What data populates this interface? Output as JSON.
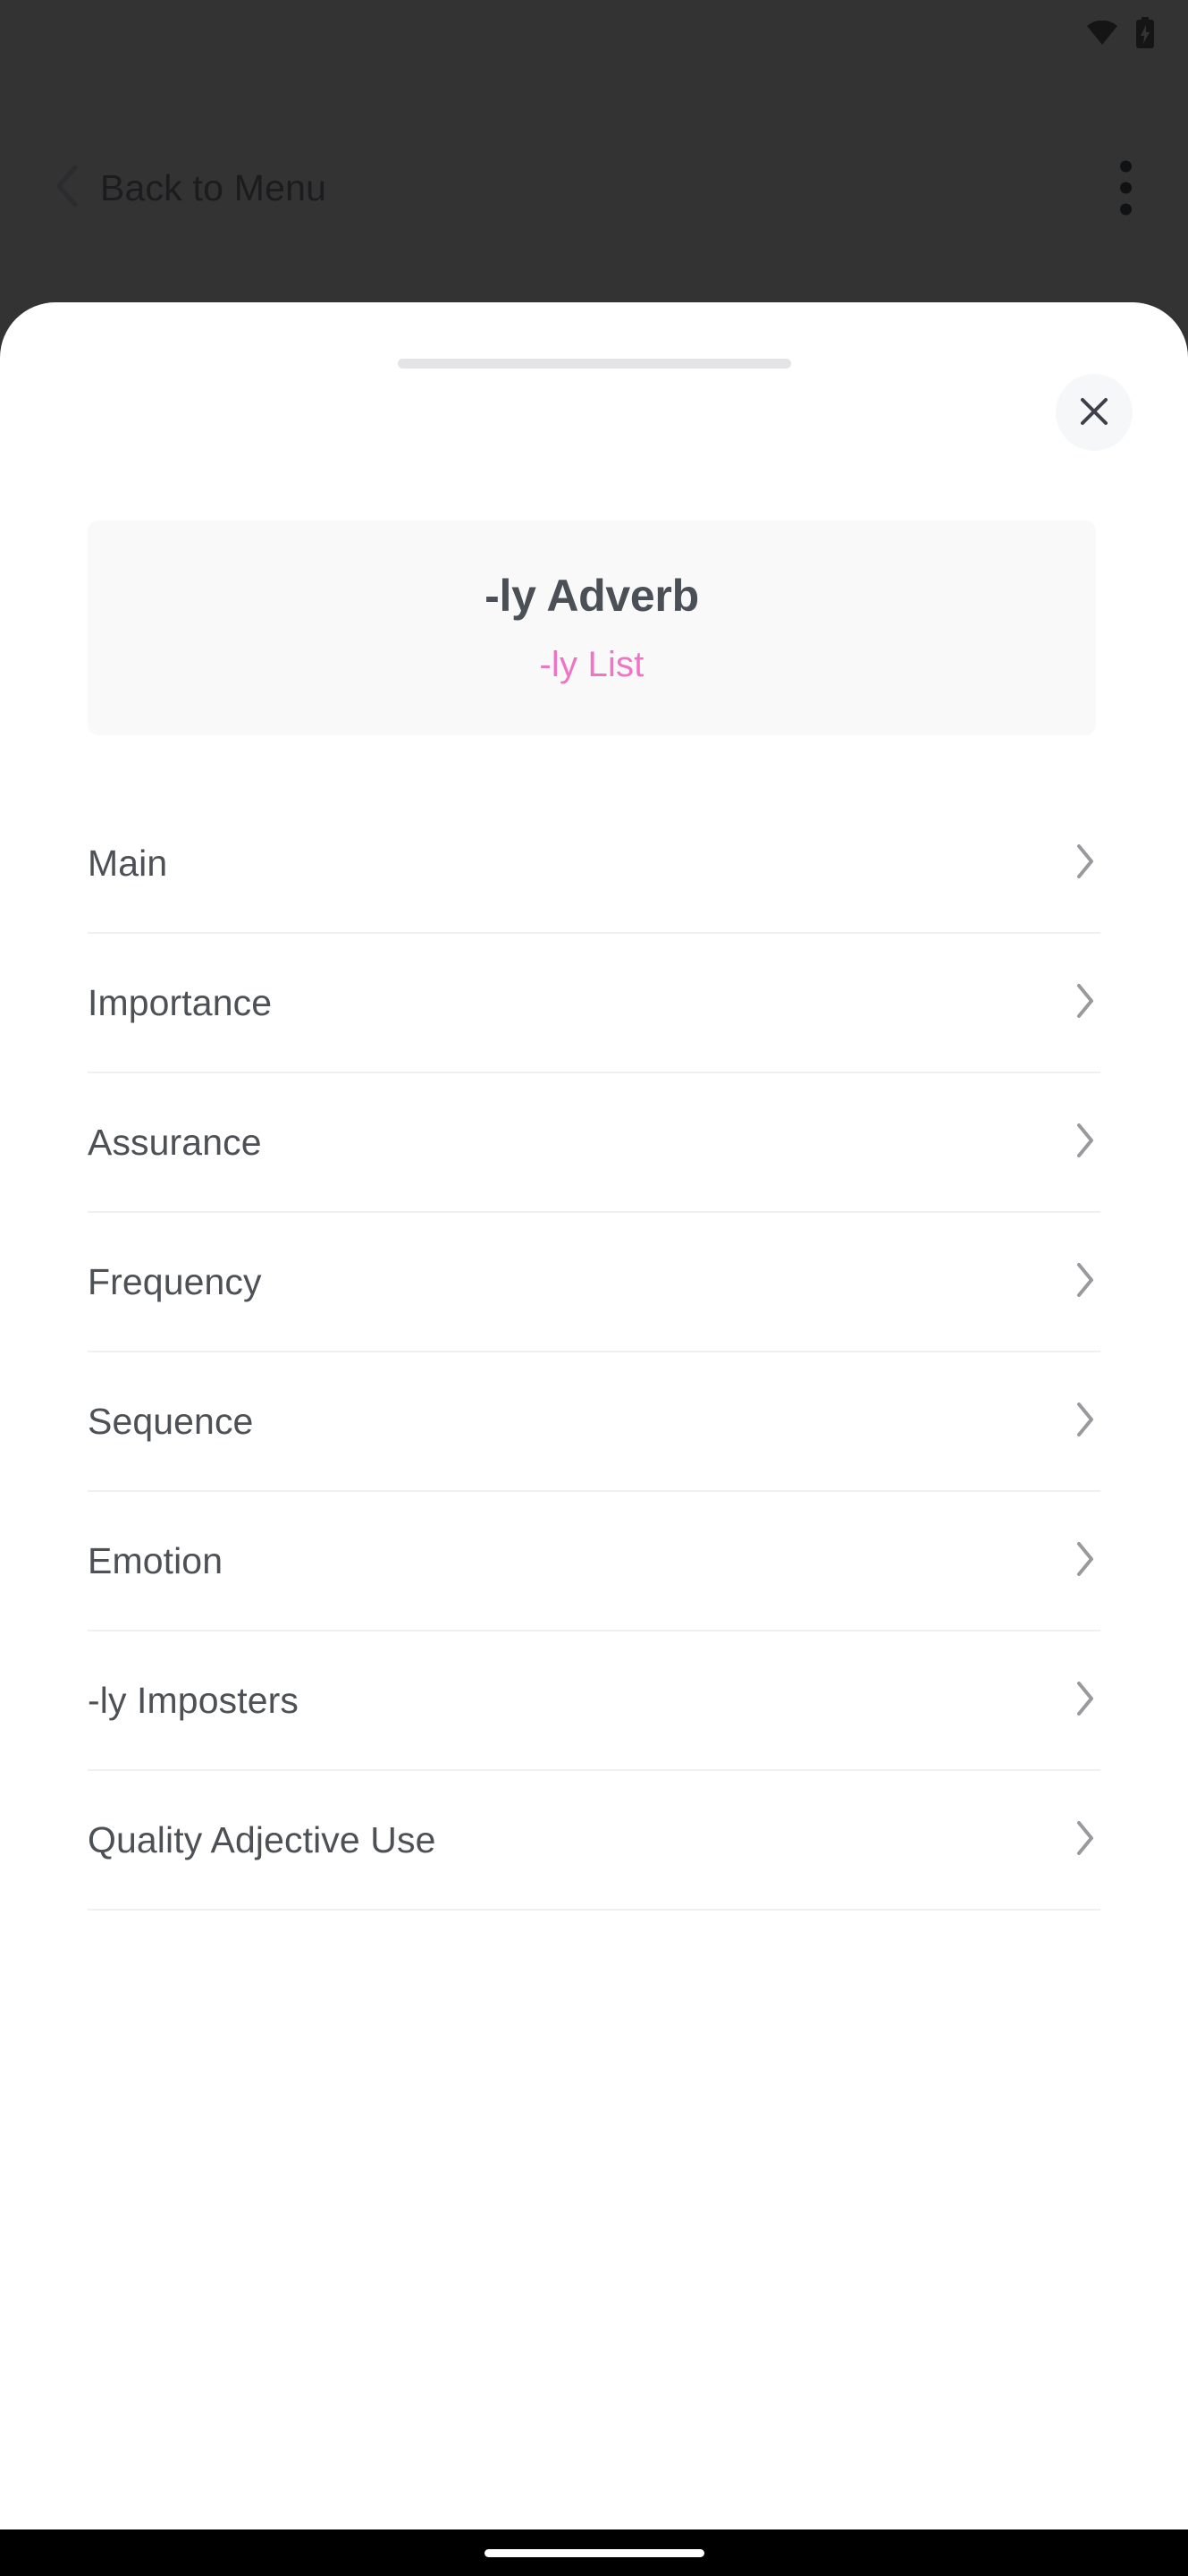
{
  "statusbar": {
    "wifi_icon": "wifi-icon",
    "battery_icon": "battery-charging-icon"
  },
  "appbar": {
    "back_label": "Back to Menu",
    "back_icon": "chevron-left-icon",
    "overflow_icon": "more-vertical-icon"
  },
  "sheet": {
    "grabber": "drag-handle",
    "close_icon": "close-icon",
    "header": {
      "title": "-ly Adverb",
      "subtitle": "-ly List"
    },
    "items": [
      {
        "label": "Main",
        "chevron": "chevron-right-icon"
      },
      {
        "label": "Importance",
        "chevron": "chevron-right-icon"
      },
      {
        "label": "Assurance",
        "chevron": "chevron-right-icon"
      },
      {
        "label": "Frequency",
        "chevron": "chevron-right-icon"
      },
      {
        "label": "Sequence",
        "chevron": "chevron-right-icon"
      },
      {
        "label": "Emotion",
        "chevron": "chevron-right-icon"
      },
      {
        "label": "-ly Imposters",
        "chevron": "chevron-right-icon"
      },
      {
        "label": "Quality Adjective Use",
        "chevron": "chevron-right-icon"
      }
    ]
  },
  "navbar": {
    "gesture_pill": "home-indicator"
  },
  "colors": {
    "accent_pink": "#f074c6",
    "scrim": "#333334",
    "card_bg": "#f9f9fa",
    "text_primary": "#4d5155",
    "divider": "#f0f0f1",
    "chevron": "#9a9a9e"
  }
}
